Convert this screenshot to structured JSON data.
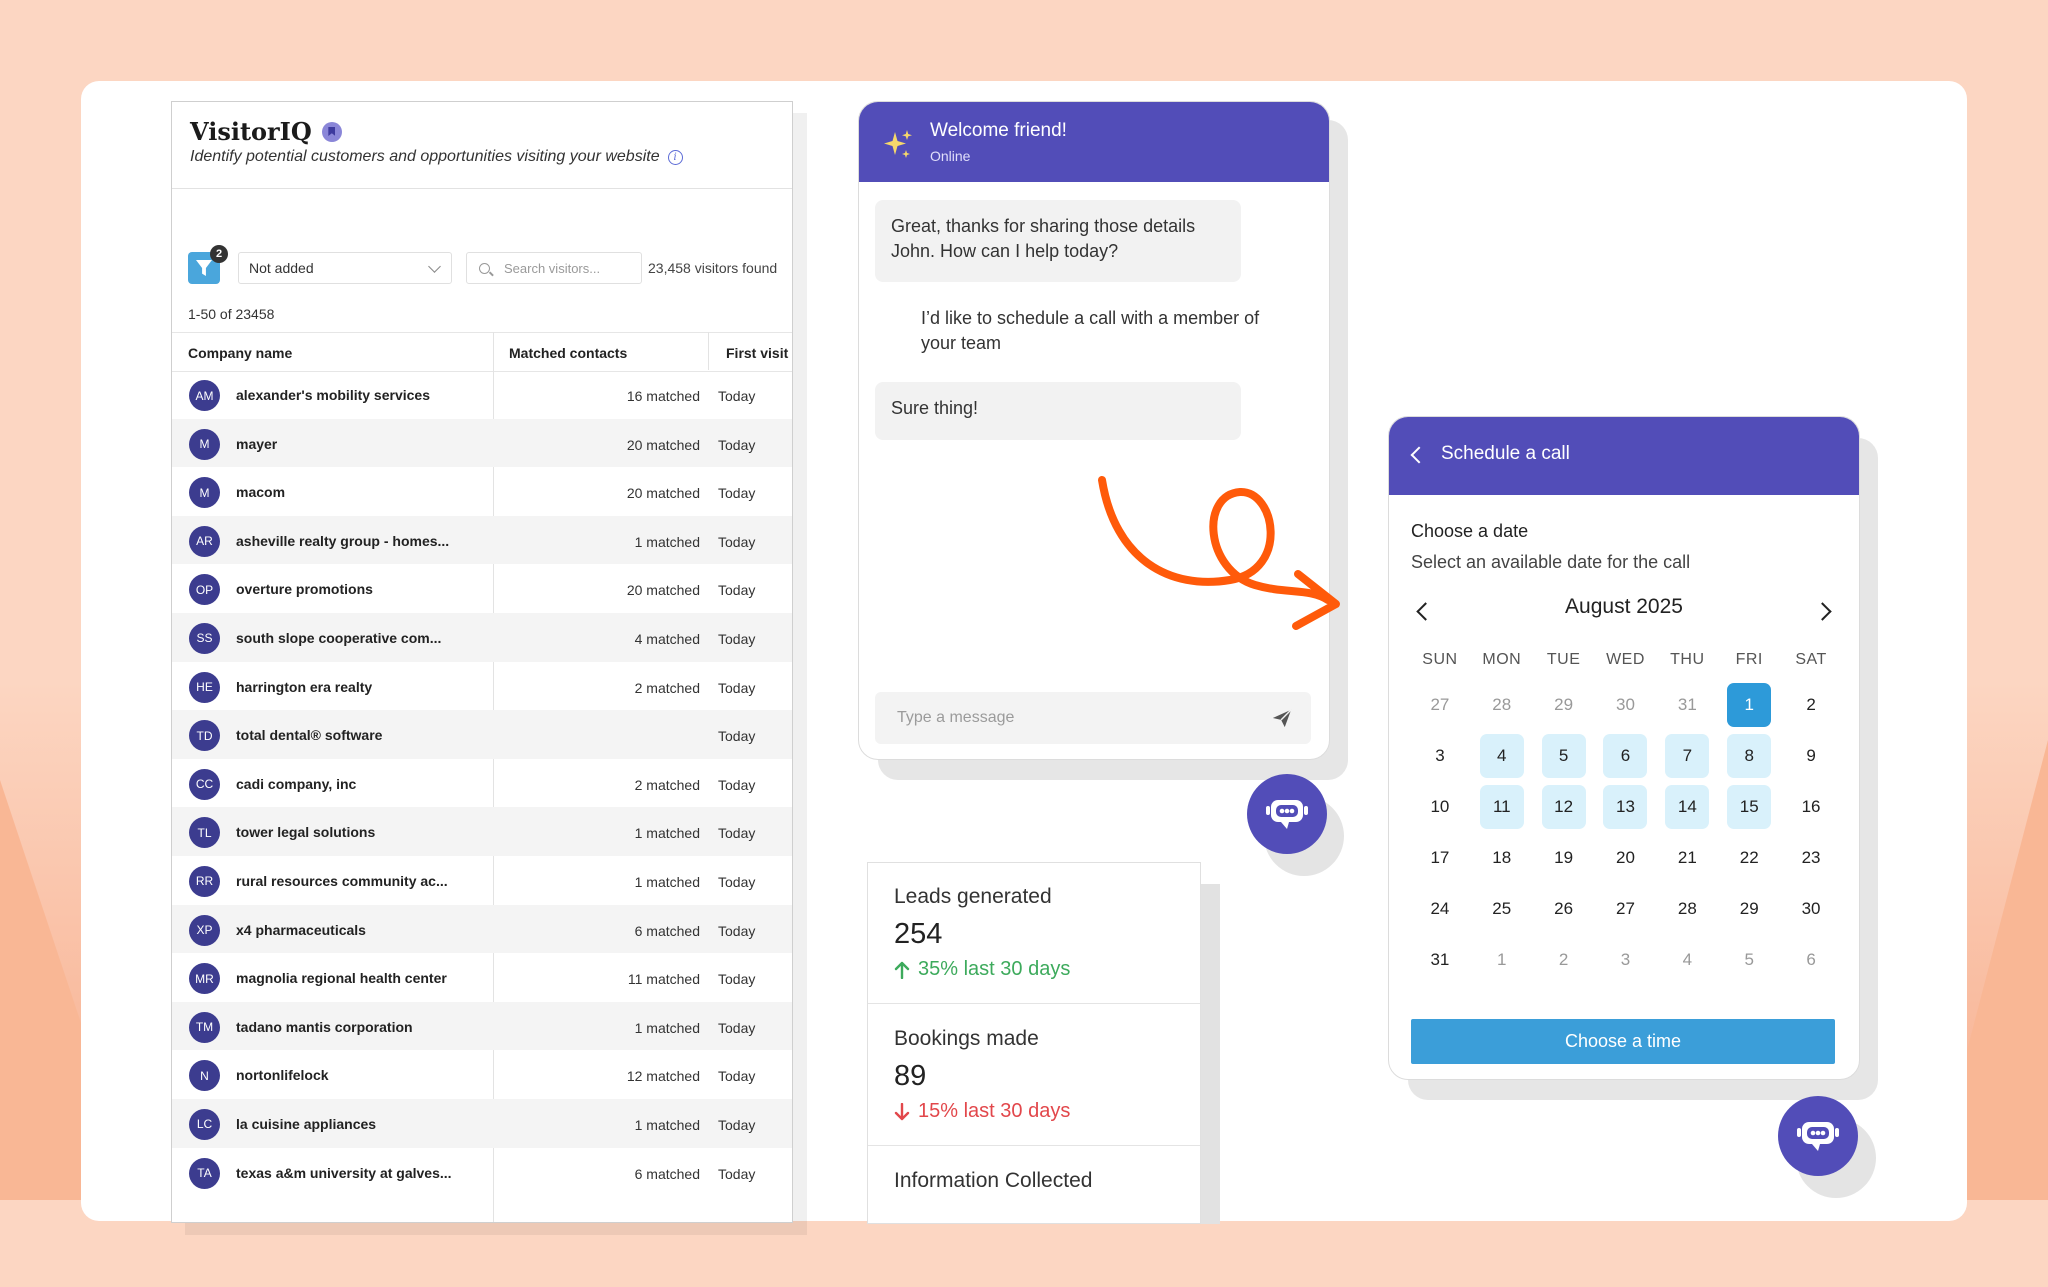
{
  "visitoriq": {
    "title": "VisitorIQ",
    "subtitle": "Identify potential customers and opportunities visiting your website",
    "filter_count": "2",
    "filter_select": "Not added",
    "search_placeholder": "Search visitors...",
    "visitors_found": "23,458 visitors found",
    "range": "1-50 of 23458",
    "columns": [
      "Company name",
      "Matched contacts",
      "First visit"
    ],
    "rows": [
      {
        "initials": "AM",
        "company": "alexander's mobility services",
        "matched": "16 matched",
        "first": "Today"
      },
      {
        "initials": "M",
        "company": "mayer",
        "matched": "20 matched",
        "first": "Today"
      },
      {
        "initials": "M",
        "company": "macom",
        "matched": "20 matched",
        "first": "Today"
      },
      {
        "initials": "AR",
        "company": "asheville realty group - homes...",
        "matched": "1 matched",
        "first": "Today"
      },
      {
        "initials": "OP",
        "company": "overture promotions",
        "matched": "20 matched",
        "first": "Today"
      },
      {
        "initials": "SS",
        "company": "south slope cooperative com...",
        "matched": "4 matched",
        "first": "Today"
      },
      {
        "initials": "HE",
        "company": "harrington era realty",
        "matched": "2 matched",
        "first": "Today"
      },
      {
        "initials": "TD",
        "company": "total dental® software",
        "matched": "",
        "first": "Today"
      },
      {
        "initials": "CC",
        "company": "cadi company, inc",
        "matched": "2 matched",
        "first": "Today"
      },
      {
        "initials": "TL",
        "company": "tower legal solutions",
        "matched": "1 matched",
        "first": "Today"
      },
      {
        "initials": "RR",
        "company": "rural resources community ac...",
        "matched": "1 matched",
        "first": "Today"
      },
      {
        "initials": "XP",
        "company": "x4 pharmaceuticals",
        "matched": "6 matched",
        "first": "Today"
      },
      {
        "initials": "MR",
        "company": "magnolia regional health center",
        "matched": "11 matched",
        "first": "Today"
      },
      {
        "initials": "TM",
        "company": "tadano mantis corporation",
        "matched": "1 matched",
        "first": "Today"
      },
      {
        "initials": "N",
        "company": "nortonlifelock",
        "matched": "12 matched",
        "first": "Today"
      },
      {
        "initials": "LC",
        "company": "la cuisine appliances",
        "matched": "1 matched",
        "first": "Today"
      },
      {
        "initials": "TA",
        "company": "texas a&m university at galves...",
        "matched": "6 matched",
        "first": "Today"
      }
    ]
  },
  "chat": {
    "title": "Welcome friend!",
    "status": "Online",
    "messages": [
      {
        "from": "bot",
        "text": "Great, thanks for sharing those details John. How can I help today?"
      },
      {
        "from": "user",
        "text": "I’d like to schedule a call with a member of your team"
      },
      {
        "from": "bot",
        "text": "Sure thing!"
      }
    ],
    "input_placeholder": "Type a message"
  },
  "stats": [
    {
      "label": "Leads generated",
      "value": "254",
      "delta": "35% last 30 days",
      "direction": "up"
    },
    {
      "label": "Bookings made",
      "value": "89",
      "delta": "15% last 30 days",
      "direction": "down"
    },
    {
      "label": "Information Collected",
      "value": "",
      "delta": "",
      "direction": ""
    }
  ],
  "schedule": {
    "title": "Schedule a call",
    "heading": "Choose a date",
    "subheading": "Select an available date for the call",
    "month": "August 2025",
    "weekdays": [
      "SUN",
      "MON",
      "TUE",
      "WED",
      "THU",
      "FRI",
      "SAT"
    ],
    "days": [
      {
        "d": "27",
        "state": "muted"
      },
      {
        "d": "28",
        "state": "muted"
      },
      {
        "d": "29",
        "state": "muted"
      },
      {
        "d": "30",
        "state": "muted"
      },
      {
        "d": "31",
        "state": "muted"
      },
      {
        "d": "1",
        "state": "selected"
      },
      {
        "d": "2",
        "state": ""
      },
      {
        "d": "3",
        "state": ""
      },
      {
        "d": "4",
        "state": "available"
      },
      {
        "d": "5",
        "state": "available"
      },
      {
        "d": "6",
        "state": "available"
      },
      {
        "d": "7",
        "state": "available"
      },
      {
        "d": "8",
        "state": "available"
      },
      {
        "d": "9",
        "state": ""
      },
      {
        "d": "10",
        "state": ""
      },
      {
        "d": "11",
        "state": "available"
      },
      {
        "d": "12",
        "state": "available"
      },
      {
        "d": "13",
        "state": "available"
      },
      {
        "d": "14",
        "state": "available"
      },
      {
        "d": "15",
        "state": "available"
      },
      {
        "d": "16",
        "state": ""
      },
      {
        "d": "17",
        "state": ""
      },
      {
        "d": "18",
        "state": ""
      },
      {
        "d": "19",
        "state": ""
      },
      {
        "d": "20",
        "state": ""
      },
      {
        "d": "21",
        "state": ""
      },
      {
        "d": "22",
        "state": ""
      },
      {
        "d": "23",
        "state": ""
      },
      {
        "d": "24",
        "state": ""
      },
      {
        "d": "25",
        "state": ""
      },
      {
        "d": "26",
        "state": ""
      },
      {
        "d": "27",
        "state": ""
      },
      {
        "d": "28",
        "state": ""
      },
      {
        "d": "29",
        "state": ""
      },
      {
        "d": "30",
        "state": ""
      },
      {
        "d": "31",
        "state": ""
      },
      {
        "d": "1",
        "state": "muted"
      },
      {
        "d": "2",
        "state": "muted"
      },
      {
        "d": "3",
        "state": "muted"
      },
      {
        "d": "4",
        "state": "muted"
      },
      {
        "d": "5",
        "state": "muted"
      },
      {
        "d": "6",
        "state": "muted"
      }
    ],
    "button": "Choose a time"
  },
  "colors": {
    "brand_purple": "#524db8",
    "accent_blue": "#3b9ed9",
    "avatar": "#3c3c8f",
    "arrow_orange": "#ff5a0a",
    "up_green": "#3daa5c",
    "down_red": "#e2474b"
  },
  "icons": [
    "bookmark-icon",
    "info-icon",
    "filter-icon",
    "chevron-down-icon",
    "search-icon",
    "sparkle-icon",
    "send-icon",
    "chatbot-icon",
    "back-icon",
    "chevron-left-icon",
    "chevron-right-icon",
    "arrow-up-icon",
    "arrow-down-icon"
  ]
}
